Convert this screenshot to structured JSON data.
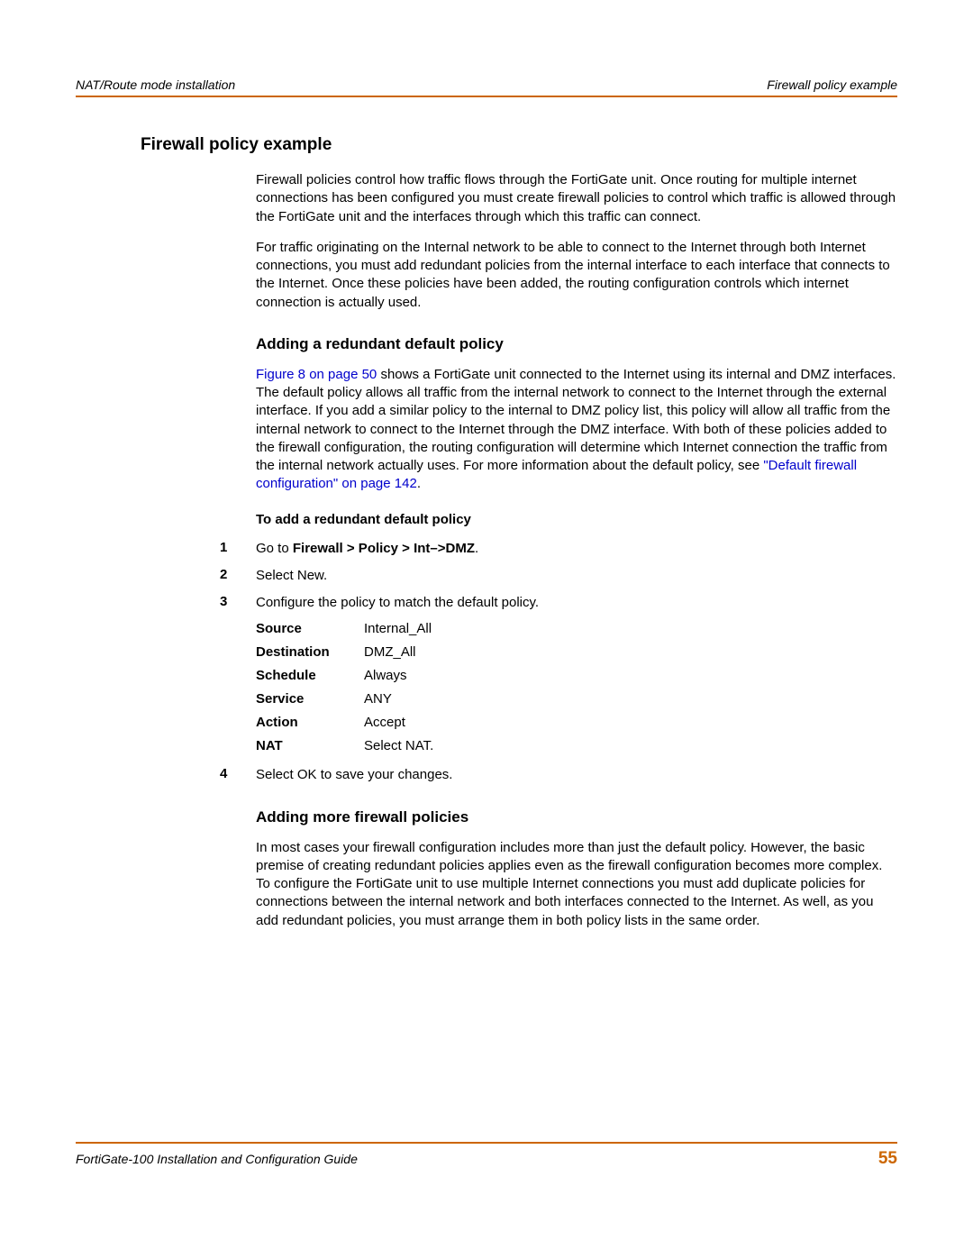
{
  "header": {
    "left": "NAT/Route mode installation",
    "right": "Firewall policy example"
  },
  "h2": "Firewall policy example",
  "para1": "Firewall policies control how traffic flows through the FortiGate unit. Once routing for multiple internet connections has been configured you must create firewall policies to control which traffic is allowed through the FortiGate unit and the interfaces through which this traffic can connect.",
  "para2": "For traffic originating on the Internal network to be able to connect to the Internet through both Internet connections, you must add redundant policies from the internal interface to each interface that connects to the Internet. Once these policies have been added, the routing configuration controls which internet connection is actually used.",
  "h3a": "Adding a redundant default policy",
  "link1": "Figure 8 on page 50",
  "para3a": " shows a FortiGate unit connected to the Internet using its internal and DMZ interfaces. The default policy allows all traffic from the internal network to connect to the Internet through the external interface. If you add a similar policy to the internal to DMZ policy list, this policy will allow all traffic from the internal network to connect to the Internet through the DMZ interface. With both of these policies added to the firewall configuration, the routing configuration will determine which Internet connection the traffic from the internal network actually uses. For more information about the default policy, see ",
  "link2": "\"Default firewall configuration\" on page 142",
  "para3b": ".",
  "boldpara": "To add a redundant default policy",
  "step1_pre": "Go to ",
  "step1_bold": "Firewall > Policy > Int–>DMZ",
  "step1_post": ".",
  "step2": "Select New.",
  "step3": "Configure the policy to match the default policy.",
  "table": {
    "r1": {
      "label": "Source",
      "value": "Internal_All"
    },
    "r2": {
      "label": "Destination",
      "value": "DMZ_All"
    },
    "r3": {
      "label": "Schedule",
      "value": "Always"
    },
    "r4": {
      "label": "Service",
      "value": "ANY"
    },
    "r5": {
      "label": "Action",
      "value": "Accept"
    },
    "r6": {
      "label": "NAT",
      "value": "Select NAT."
    }
  },
  "step4": "Select OK to save your changes.",
  "h3b": "Adding more firewall policies",
  "para4": "In most cases your firewall configuration includes more than just the default policy. However, the basic premise of creating redundant policies applies even as the firewall configuration becomes more complex. To configure the FortiGate unit to use multiple Internet connections you must add duplicate policies for connections between the internal network and both interfaces connected to the Internet. As well, as you add redundant policies, you must arrange them in both policy lists in the same order.",
  "footer": {
    "text": "FortiGate-100 Installation and Configuration Guide",
    "page": "55"
  },
  "nums": {
    "n1": "1",
    "n2": "2",
    "n3": "3",
    "n4": "4"
  }
}
